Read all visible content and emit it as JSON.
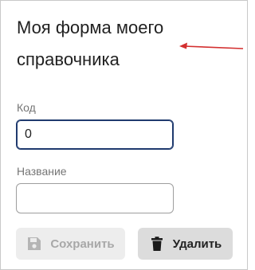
{
  "form": {
    "title": "Моя форма моего справочника",
    "fields": [
      {
        "label": "Код",
        "value": "0",
        "placeholder": ""
      },
      {
        "label": "Название",
        "value": "",
        "placeholder": ""
      }
    ]
  },
  "buttons": {
    "save_label": "Сохранить",
    "delete_label": "Удалить"
  },
  "icons": {
    "save": "floppy-disk-icon",
    "delete": "trash-icon",
    "annotation": "red-arrow-icon"
  },
  "colors": {
    "annotation_arrow": "#d32f2f",
    "focused_border": "#1f3a6e",
    "save_bg_disabled": "#ededed",
    "delete_bg": "#dcdcdc"
  }
}
